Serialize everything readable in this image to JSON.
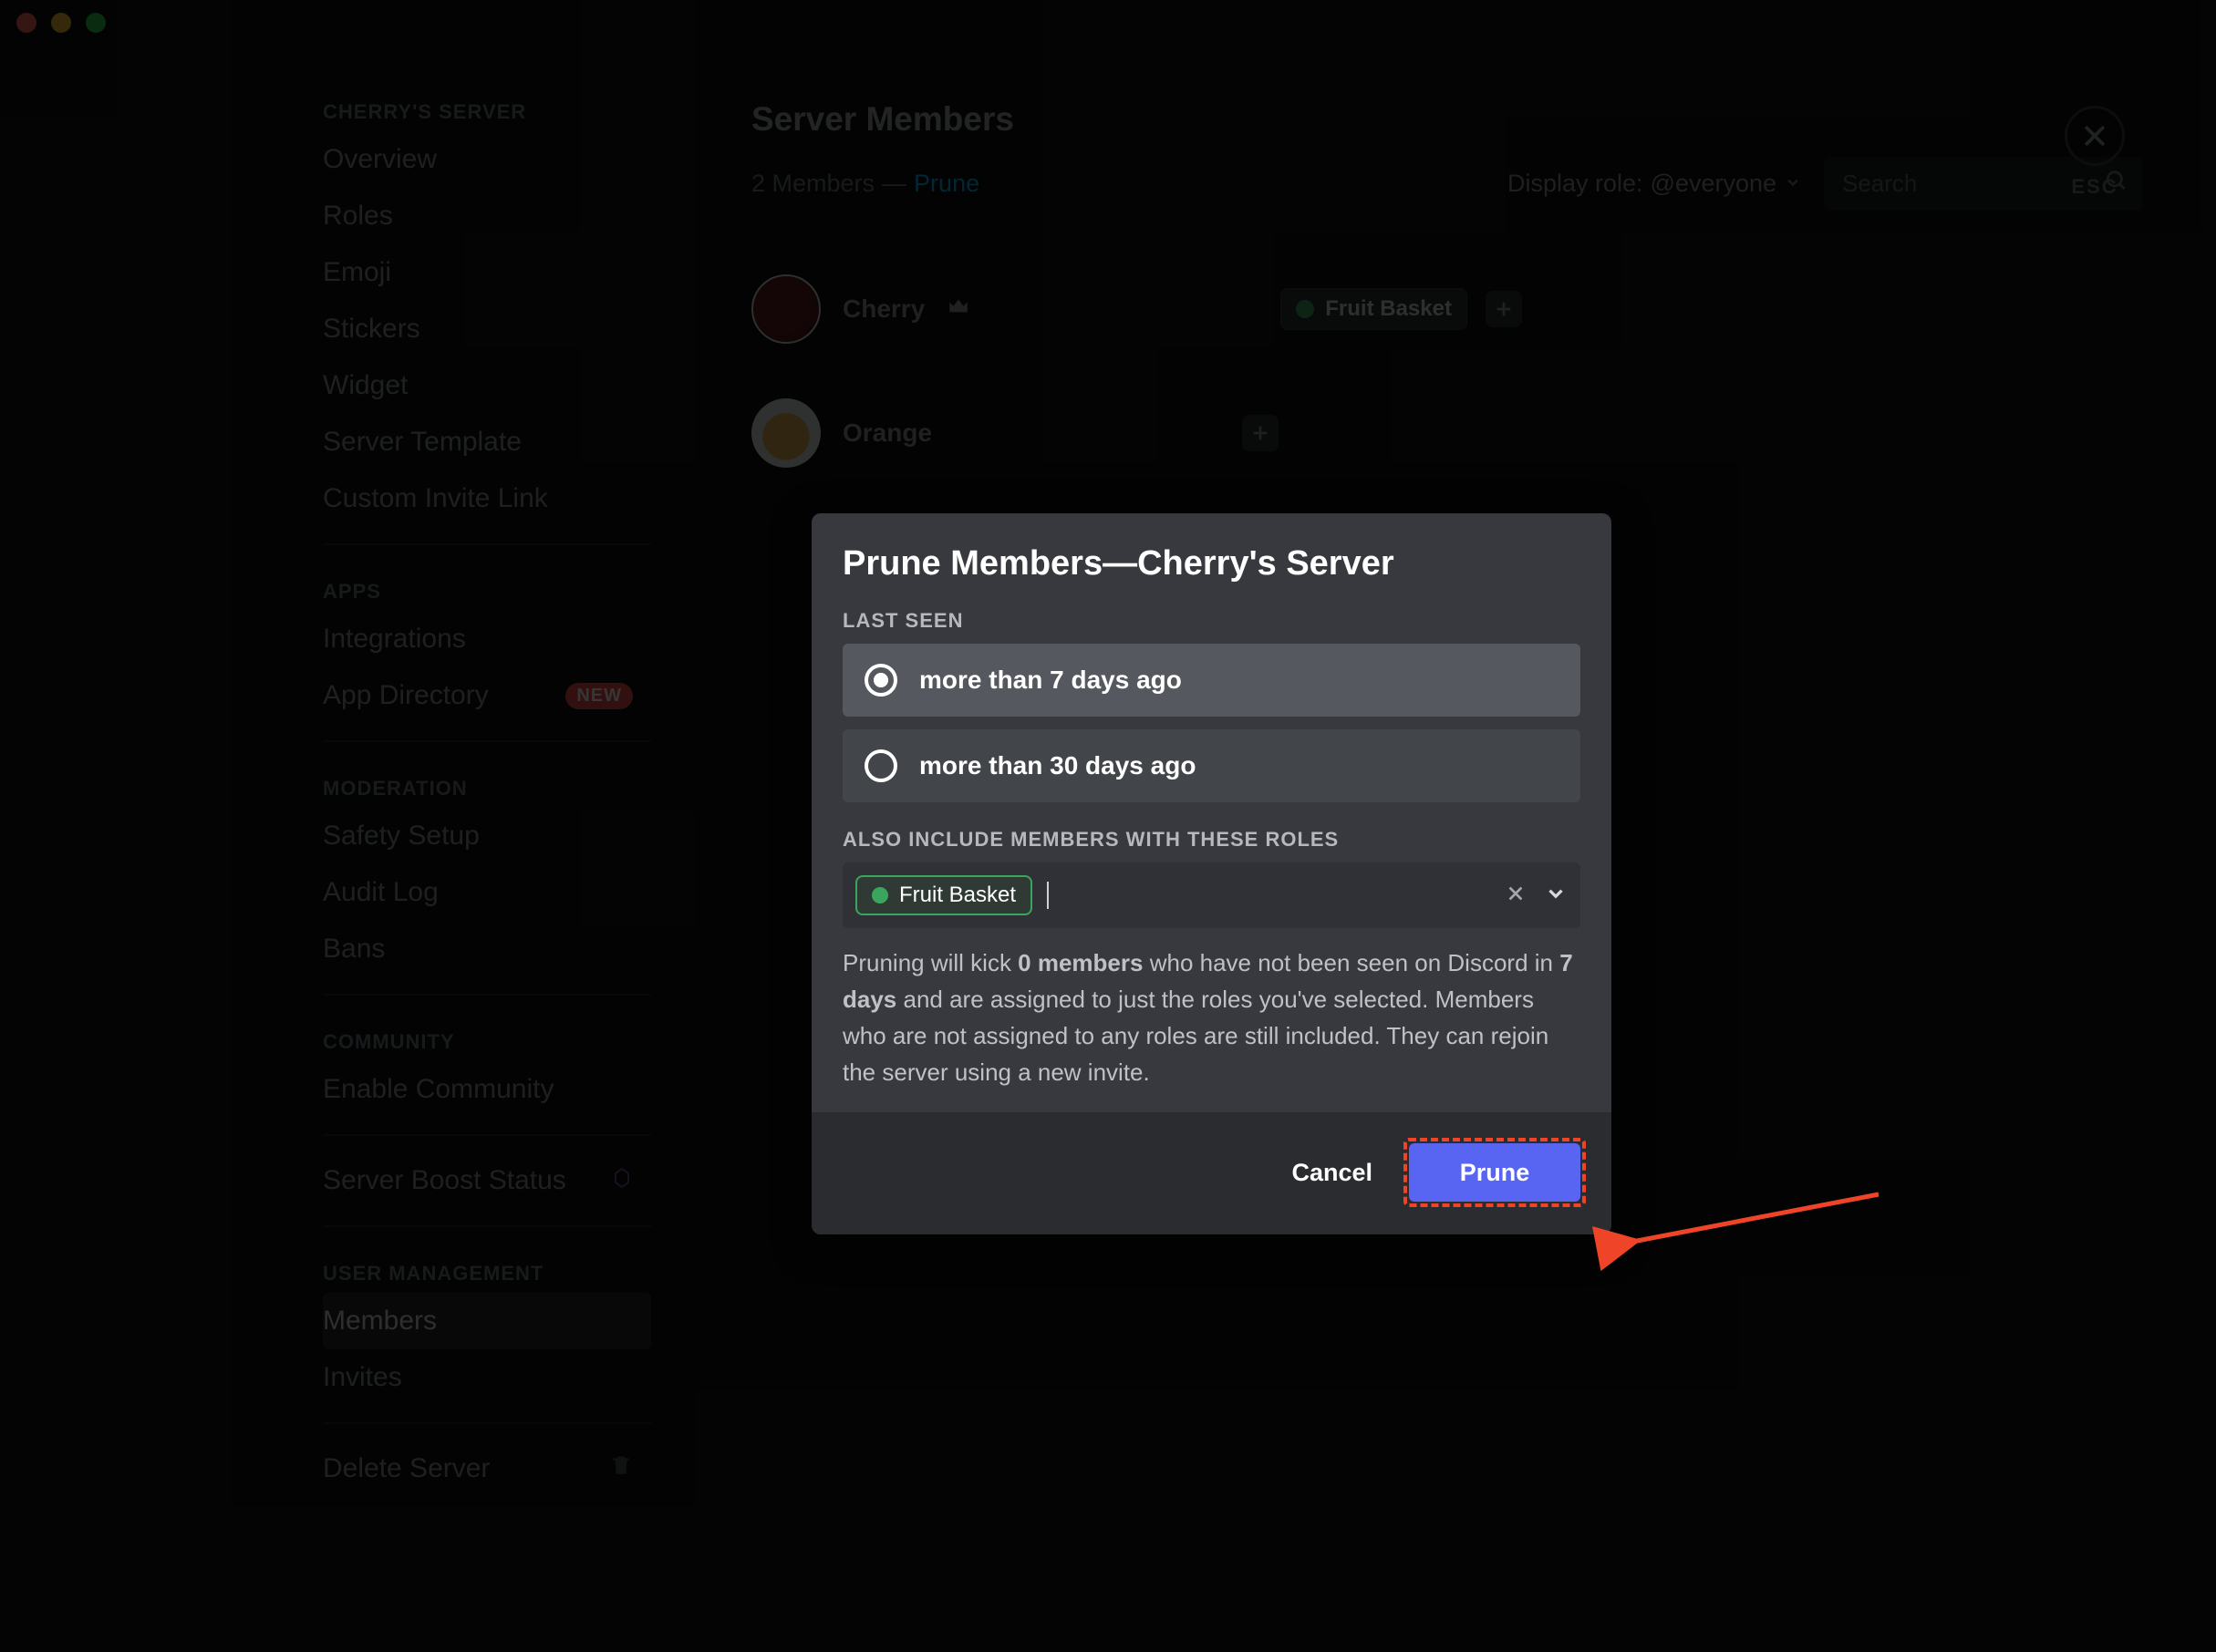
{
  "window": {
    "esc_label": "ESC"
  },
  "sidebar": {
    "server_name": "CHERRY'S SERVER",
    "items": {
      "overview": "Overview",
      "roles": "Roles",
      "emoji": "Emoji",
      "stickers": "Stickers",
      "widget": "Widget",
      "server_template": "Server Template",
      "custom_invite": "Custom Invite Link"
    },
    "apps_cat": "APPS",
    "apps": {
      "integrations": "Integrations",
      "directory": "App Directory",
      "directory_badge": "NEW"
    },
    "mod_cat": "MODERATION",
    "mod": {
      "safety": "Safety Setup",
      "audit": "Audit Log",
      "bans": "Bans"
    },
    "comm_cat": "COMMUNITY",
    "comm": {
      "enable": "Enable Community"
    },
    "boost": "Server Boost Status",
    "user_cat": "USER MANAGEMENT",
    "user": {
      "members": "Members",
      "invites": "Invites"
    },
    "delete": "Delete Server"
  },
  "main": {
    "title": "Server Members",
    "count": "2 Members",
    "em_dash": "—",
    "prune_link": "Prune",
    "display_role_label": "Display role:",
    "display_role_value": "@everyone",
    "search_placeholder": "Search",
    "members": [
      {
        "name": "Cherry",
        "owner": true,
        "roles": [
          "Fruit Basket"
        ]
      },
      {
        "name": "Orange",
        "owner": false,
        "roles": []
      }
    ]
  },
  "modal": {
    "title": "Prune Members—Cherry's Server",
    "last_seen_cat": "LAST SEEN",
    "opts": {
      "d7": "more than 7 days ago",
      "d30": "more than 30 days ago"
    },
    "roles_cat": "ALSO INCLUDE MEMBERS WITH THESE ROLES",
    "selected_role": "Fruit Basket",
    "desc_pre": "Pruning will kick ",
    "desc_count": "0 members",
    "desc_mid1": " who have not been seen on Discord in ",
    "desc_days": "7 days",
    "desc_post": " and are assigned to just the roles you've selected. Members who are not assigned to any roles are still included. They can rejoin the server using a new invite.",
    "cancel": "Cancel",
    "prune": "Prune"
  }
}
